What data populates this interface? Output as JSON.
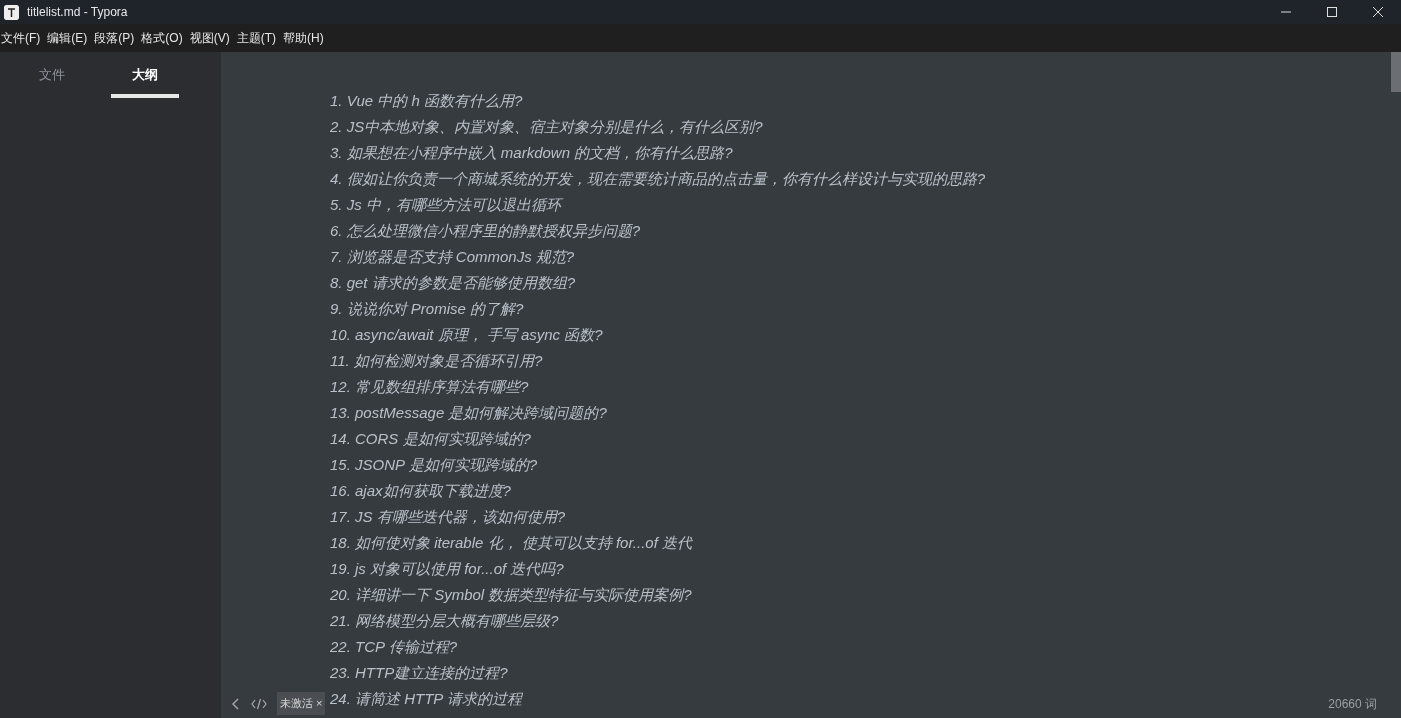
{
  "window": {
    "title": "titlelist.md - Typora"
  },
  "menu": [
    "文件(F)",
    "编辑(E)",
    "段落(P)",
    "格式(O)",
    "视图(V)",
    "主题(T)",
    "帮助(H)"
  ],
  "sidebar": {
    "tabs": [
      {
        "label": "文件",
        "selected": false
      },
      {
        "label": "大纲",
        "selected": true
      }
    ]
  },
  "outline": [
    "1. Vue 中的 h 函数有什么用?",
    "2. JS中本地对象、内置对象、宿主对象分别是什么，有什么区别?",
    "3. 如果想在小程序中嵌入 markdown 的文档，你有什么思路?",
    "4. 假如让你负责一个商城系统的开发，现在需要统计商品的点击量，你有什么样设计与实现的思路?",
    "5. Js 中，有哪些方法可以退出循环",
    "6. 怎么处理微信小程序里的静默授权异步问题?",
    "7. 浏览器是否支持 CommonJs 规范?",
    "8. get 请求的参数是否能够使用数组?",
    "9. 说说你对 Promise 的了解?",
    "10. async/await 原理， 手写 async 函数?",
    "11. 如何检测对象是否循环引用?",
    "12. 常见数组排序算法有哪些?",
    "13. postMessage 是如何解决跨域问题的?",
    "14. CORS 是如何实现跨域的?",
    "15. JSONP 是如何实现跨域的?",
    "16. ajax如何获取下载进度?",
    "17. JS 有哪些迭代器，该如何使用?",
    "18. 如何使对象 iterable 化， 使其可以支持 for...of 迭代",
    "19. js 对象可以使用 for...of 迭代吗?",
    "20. 详细讲一下 Symbol 数据类型特征与实际使用案例?",
    "21. 网络模型分层大概有哪些层级?",
    "22. TCP 传输过程?",
    "23. HTTP建立连接的过程?",
    "24. 请简述 HTTP 请求的过程"
  ],
  "footer": {
    "badge": "未激活 ×",
    "word_count": "20660 词"
  }
}
